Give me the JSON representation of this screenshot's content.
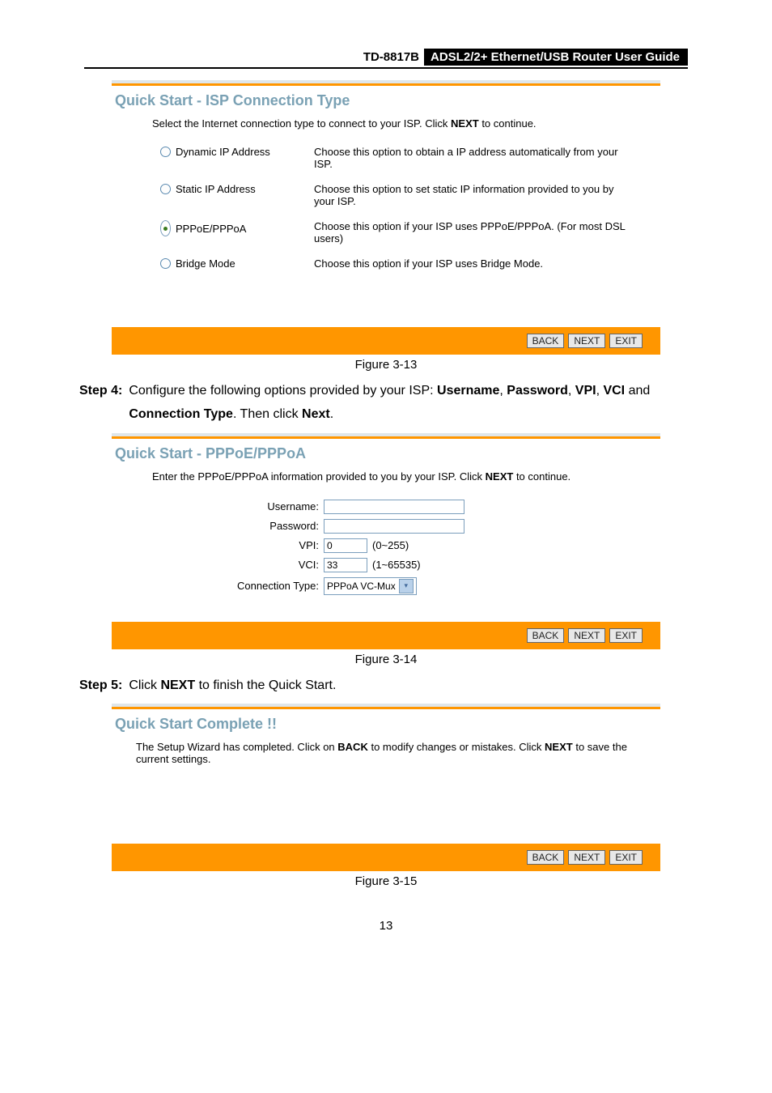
{
  "header": {
    "device": "TD-8817B",
    "title": "ADSL2/2+  Ethernet/USB  Router  User  Guide"
  },
  "card1": {
    "title": "Quick Start - ISP Connection Type",
    "intro_a": "Select the Internet connection type to connect to your ISP. Click ",
    "intro_b": "NEXT",
    "intro_c": " to continue.",
    "opts": [
      {
        "label": "Dynamic IP Address",
        "desc": "Choose this option to obtain a IP address automatically from your ISP.",
        "sel": false
      },
      {
        "label": "Static IP Address",
        "desc": "Choose this option to set static IP information provided to you by your ISP.",
        "sel": false
      },
      {
        "label": "PPPoE/PPPoA",
        "desc": "Choose this option if your ISP uses PPPoE/PPPoA. (For most DSL users)",
        "sel": true
      },
      {
        "label": "Bridge Mode",
        "desc": "Choose this option if your ISP uses Bridge Mode.",
        "sel": false
      }
    ],
    "buttons": {
      "back": "BACK",
      "next": "NEXT",
      "exit": "EXIT"
    },
    "figcap": "Figure 3-13"
  },
  "step4": {
    "label": "Step 4:",
    "t1": "Configure the following options provided by your ISP: ",
    "k1": "Username",
    "sep": ", ",
    "k2": "Password",
    "k3": "VPI",
    "k4": "VCI",
    "t2": " and ",
    "k5": "Connection Type",
    "t3": ". Then click ",
    "k6": "Next",
    "t4": "."
  },
  "card2": {
    "title": "Quick Start - PPPoE/PPPoA",
    "intro_a": "Enter the PPPoE/PPPoA information provided to you by your ISP. Click ",
    "intro_b": "NEXT",
    "intro_c": " to continue.",
    "labels": {
      "user": "Username:",
      "pass": "Password:",
      "vpi": "VPI:",
      "vci": "VCI:",
      "ct": "Connection Type:"
    },
    "values": {
      "user": "",
      "pass": "",
      "vpi": "0",
      "vci": "33",
      "ct": "PPPoA VC-Mux"
    },
    "hints": {
      "vpi": "(0~255)",
      "vci": "(1~65535)"
    },
    "buttons": {
      "back": "BACK",
      "next": "NEXT",
      "exit": "EXIT"
    },
    "figcap": "Figure 3-14"
  },
  "step5": {
    "label": "Step 5:",
    "t1": "Click ",
    "k1": "NEXT",
    "t2": " to finish the Quick Start."
  },
  "card3": {
    "title": "Quick Start Complete !!",
    "intro_a": "The Setup Wizard has completed. Click on ",
    "intro_b": "BACK",
    "intro_c": " to modify changes or mistakes. Click ",
    "intro_d": "NEXT",
    "intro_e": " to save the current settings.",
    "buttons": {
      "back": "BACK",
      "next": "NEXT",
      "exit": "EXIT"
    },
    "figcap": "Figure 3-15"
  },
  "pagenum": "13"
}
